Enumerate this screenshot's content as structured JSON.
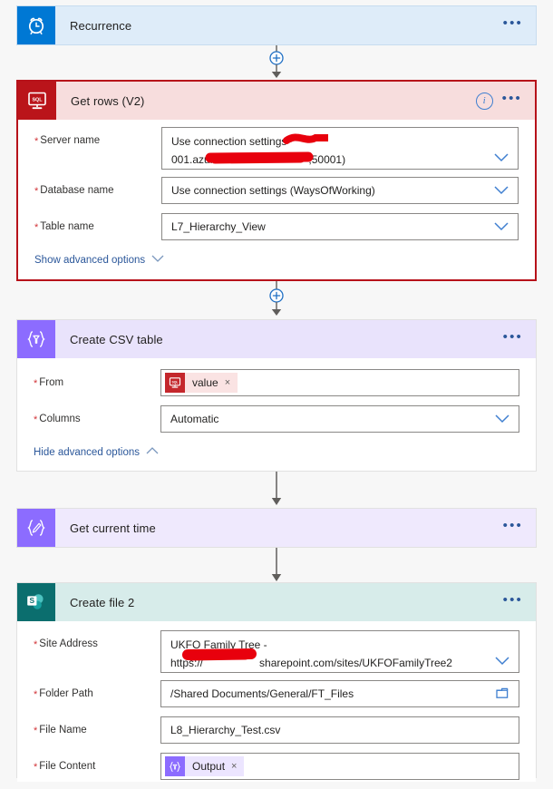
{
  "flow": {
    "steps": [
      {
        "id": "recurrence",
        "title": "Recurrence",
        "icon": "alarm-clock-icon",
        "icon_bg": "#0078d4",
        "header_bg": "#deecf9",
        "border": "#c7dcef",
        "selected": false,
        "expanded": false,
        "has_info": false,
        "menu": "•••"
      },
      {
        "id": "get-rows-v2",
        "title": "Get rows (V2)",
        "icon": "sql-server-icon",
        "icon_bg": "#ba141a",
        "header_bg": "#f7dddd",
        "border": "#b7121a",
        "selected": true,
        "expanded": true,
        "has_info": true,
        "menu": "•••",
        "info": "i",
        "fields": [
          {
            "label": "Server name",
            "required": true,
            "type": "dropdown-multiline",
            "value_line1": "Use connection settings",
            "value_line1_redacted": true,
            "value_line2_pre": "001.azure.uk",
            "value_line2_redacted": true,
            "value_line2_post": ",50001)"
          },
          {
            "label": "Database name",
            "required": true,
            "type": "dropdown",
            "value": "Use connection settings (WaysOfWorking)"
          },
          {
            "label": "Table name",
            "required": true,
            "type": "dropdown",
            "value": "L7_Hierarchy_View"
          }
        ],
        "advanced": {
          "label": "Show advanced options",
          "state": "collapsed"
        }
      },
      {
        "id": "create-csv-table",
        "title": "Create CSV table",
        "icon": "data-operation-icon",
        "icon_bg": "#8c6cff",
        "header_bg": "#e9e3fc",
        "border": "#e1e1e1",
        "selected": false,
        "expanded": true,
        "has_info": false,
        "menu": "•••",
        "fields": [
          {
            "label": "From",
            "required": true,
            "type": "token",
            "token": {
              "label": "value",
              "icon": "sql-server-icon",
              "style": "sql",
              "remove": "×"
            }
          },
          {
            "label": "Columns",
            "required": true,
            "type": "dropdown",
            "value": "Automatic"
          }
        ],
        "advanced": {
          "label": "Hide advanced options",
          "state": "expanded"
        }
      },
      {
        "id": "get-current-time",
        "title": "Get current time",
        "icon": "expression-pencil-icon",
        "icon_bg": "#8c6cff",
        "header_bg": "#efe9fd",
        "border": "#e1e1e1",
        "selected": false,
        "expanded": false,
        "has_info": false,
        "menu": "•••"
      },
      {
        "id": "create-file-2",
        "title": "Create file 2",
        "icon": "sharepoint-icon",
        "icon_bg": "#0b6e6e",
        "header_bg": "#d7ecea",
        "border": "#e1e1e1",
        "selected": false,
        "expanded": true,
        "has_info": false,
        "menu": "•••",
        "fields": [
          {
            "label": "Site Address",
            "required": true,
            "type": "dropdown-multiline",
            "value_line1": "UKFO Family Tree -",
            "value_line1_redacted": false,
            "value_line2_pre": "https://",
            "value_line2_redacted": true,
            "value_line2_post": "sharepoint.com/sites/UKFOFamilyTree2"
          },
          {
            "label": "Folder Path",
            "required": true,
            "type": "folder-picker",
            "value": "/Shared Documents/General/FT_Files"
          },
          {
            "label": "File Name",
            "required": true,
            "type": "text",
            "value": "L8_Hierarchy_Test.csv"
          },
          {
            "label": "File Content",
            "required": true,
            "type": "token",
            "token": {
              "label": "Output",
              "icon": "expression-icon",
              "style": "expr",
              "remove": "×"
            }
          }
        ]
      }
    ],
    "connectors": [
      {
        "after": "recurrence",
        "type": "add-plus"
      },
      {
        "after": "get-rows-v2",
        "type": "add-plus"
      },
      {
        "after": "create-csv-table",
        "type": "arrow"
      },
      {
        "after": "get-current-time",
        "type": "arrow"
      }
    ],
    "add_step_glyph": "+",
    "colors": {
      "accent_blue": "#0078d4",
      "link_blue": "#2b579a",
      "required_red": "#d13438",
      "selection_red": "#b7121a",
      "redaction_red": "#e8000d",
      "canvas_bg": "#f7f7f7"
    }
  }
}
